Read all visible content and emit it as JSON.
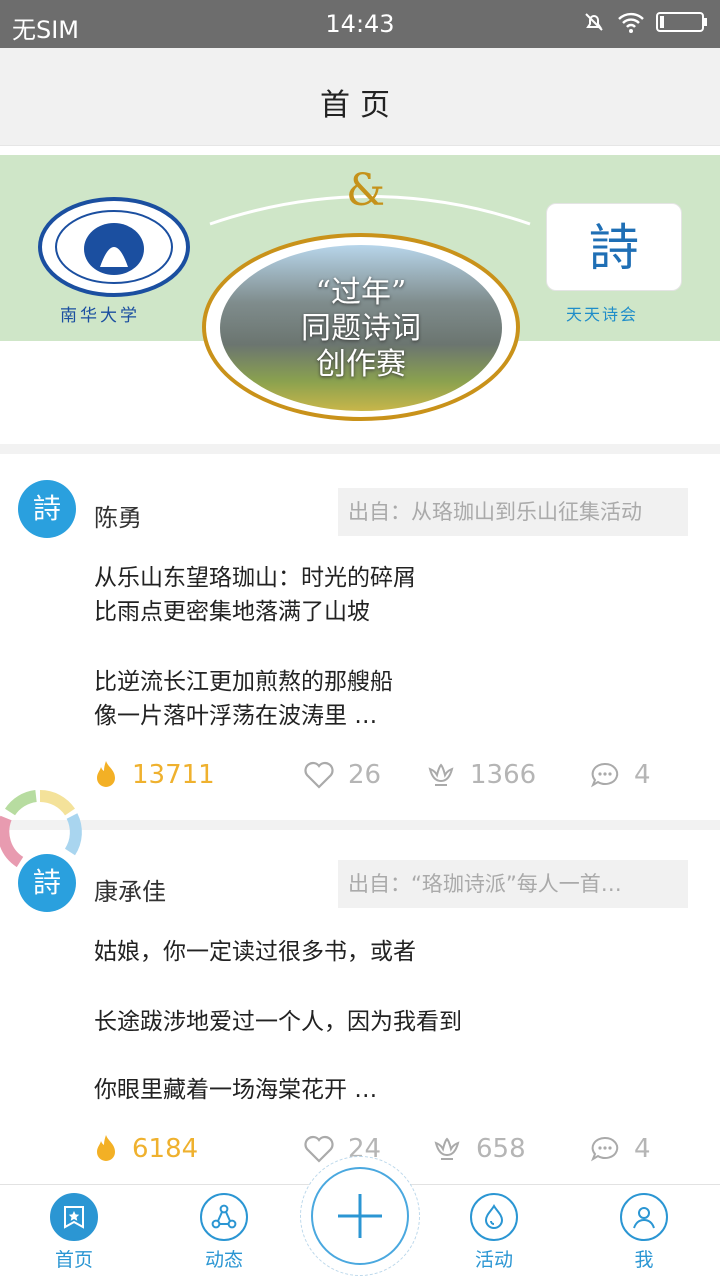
{
  "status_bar": {
    "carrier": "无SIM",
    "time": "14:43"
  },
  "nav": {
    "title": "首页"
  },
  "banner": {
    "left_logo_text": "南华大学",
    "right_logo_char": "詩",
    "right_logo_text": "天天诗会",
    "ampersand": "&",
    "center_lines": [
      "“过年”",
      "同题诗词",
      "创作赛"
    ]
  },
  "posts": [
    {
      "avatar_char": "詩",
      "author": "陈勇",
      "source": "出自：从珞珈山到乐山征集活动",
      "lines": [
        "从乐山东望珞珈山：时光的碎屑",
        "比雨点更密集地落满了山坡",
        "比逆流长江更加煎熬的那艘船",
        "像一片落叶浮荡在波涛里 …"
      ],
      "hot": "13711",
      "likes": "26",
      "flowers": "1366",
      "comments": "4"
    },
    {
      "avatar_char": "詩",
      "author": "康承佳",
      "source": "出自：“珞珈诗派”每人一首…",
      "lines": [
        "姑娘，你一定读过很多书，或者",
        "长途跋涉地爱过一个人，因为我看到",
        "你眼里藏着一场海棠花开 …"
      ],
      "hot": "6184",
      "likes": "24",
      "flowers": "658",
      "comments": "4"
    }
  ],
  "tabs": [
    {
      "label": "首页",
      "icon": "home-star-icon"
    },
    {
      "label": "动态",
      "icon": "share-nodes-icon"
    },
    {
      "label": "活动",
      "icon": "droplet-icon"
    },
    {
      "label": "我",
      "icon": "user-icon"
    }
  ],
  "fab": {
    "icon": "plus-icon"
  }
}
